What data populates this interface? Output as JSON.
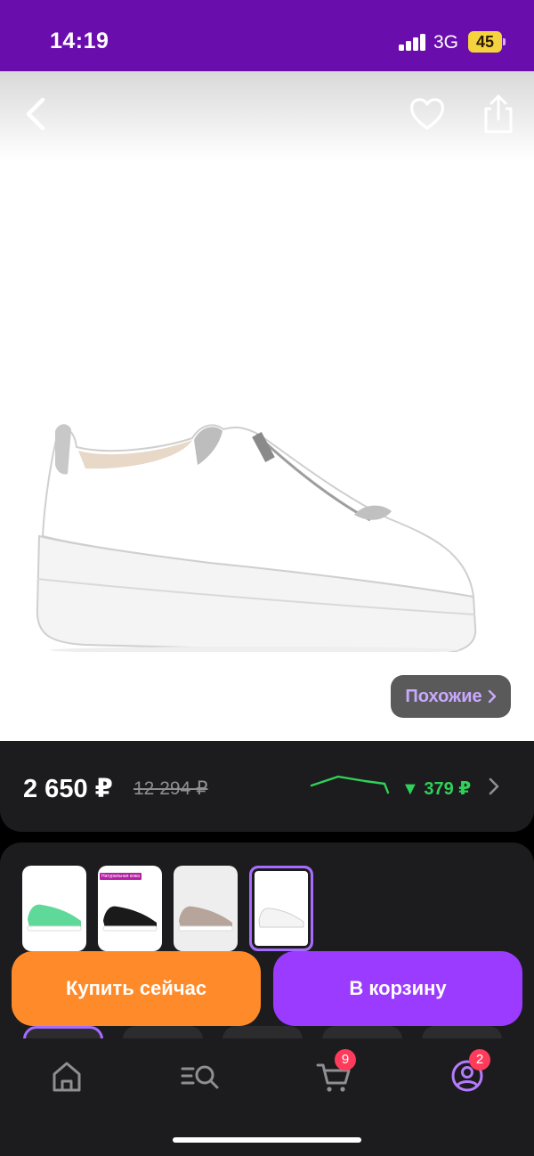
{
  "status_bar": {
    "time": "14:19",
    "network": "3G",
    "battery": "45",
    "battery_color": "#f5d33f",
    "background": "#6a0dad"
  },
  "product": {
    "back_icon": "chevron-left-icon",
    "favorite_icon": "heart-icon",
    "share_icon": "share-icon",
    "image": "white-leather-zip-sneaker",
    "similar_label": "Похожие"
  },
  "price": {
    "current": "2 650 ₽",
    "old": "12 294 ₽",
    "drop": "▼ 379 ₽",
    "drop_color": "#30d158"
  },
  "variants": {
    "items": [
      {
        "name": "green",
        "badge": ""
      },
      {
        "name": "black",
        "badge": "Натуральная кожа"
      },
      {
        "name": "beige",
        "badge": ""
      },
      {
        "name": "white",
        "badge": "",
        "selected": true
      }
    ]
  },
  "actions": {
    "buy_now": "Купить сейчас",
    "add_to_cart": "В корзину",
    "buy_color": "#ff8a2a",
    "cart_color": "#9a3bff"
  },
  "tab_bar": {
    "items": [
      {
        "name": "home",
        "icon": "home-icon"
      },
      {
        "name": "catalog",
        "icon": "catalog-search-icon"
      },
      {
        "name": "cart",
        "icon": "cart-icon",
        "badge": "9"
      },
      {
        "name": "profile",
        "icon": "profile-icon",
        "badge": "2",
        "active": true
      }
    ]
  }
}
